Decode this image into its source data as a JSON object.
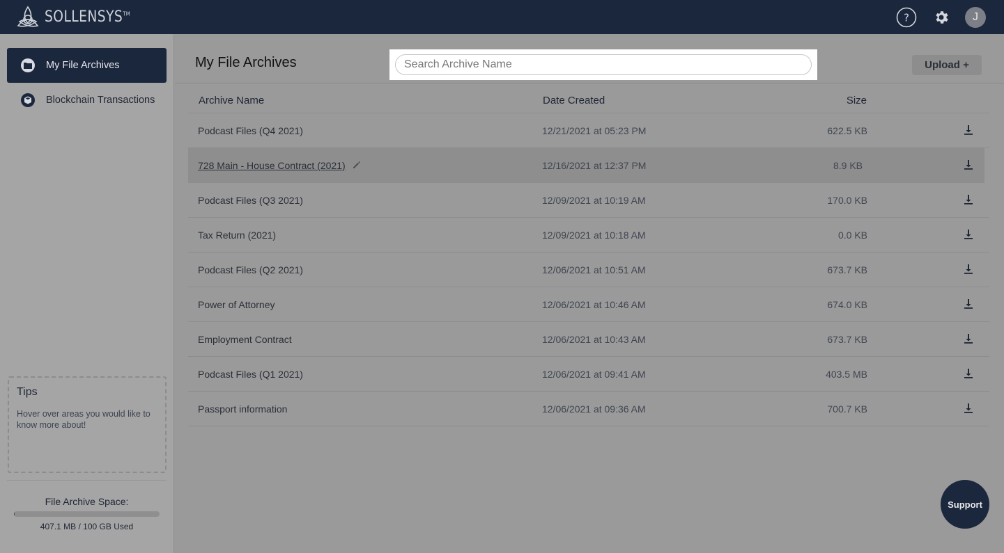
{
  "app": {
    "brand": "SOLLENSYS",
    "trademark": "TM"
  },
  "topbar": {
    "help_icon": "help-circle-icon",
    "settings_icon": "gear-icon",
    "avatar_initial": "J"
  },
  "sidebar": {
    "items": [
      {
        "label": "My File Archives",
        "icon": "folder-icon",
        "active": true
      },
      {
        "label": "Blockchain Transactions",
        "icon": "cube-icon",
        "active": false
      }
    ],
    "tips": {
      "title": "Tips",
      "text": "Hover over areas you would like to know more about!"
    },
    "storage": {
      "title": "File Archive Space:",
      "used_label": "407.1 MB / 100 GB Used",
      "fraction_used": 0.004
    }
  },
  "main": {
    "title": "My File Archives",
    "search": {
      "placeholder": "Search Archive Name",
      "value": ""
    },
    "upload_label": "Upload +",
    "columns": {
      "name": "Archive Name",
      "date": "Date Created",
      "size": "Size"
    },
    "rows": [
      {
        "name": "Podcast Files (Q4 2021)",
        "date": "12/21/2021 at 05:23 PM",
        "size": "622.5 KB"
      },
      {
        "name": "728 Main - House Contract (2021)",
        "date": "12/16/2021 at 12:37 PM",
        "size": "8.9 KB",
        "hover": true
      },
      {
        "name": "Podcast Files (Q3 2021)",
        "date": "12/09/2021 at 10:19 AM",
        "size": "170.0 KB"
      },
      {
        "name": "Tax Return (2021)",
        "date": "12/09/2021 at 10:18 AM",
        "size": "0.0 KB"
      },
      {
        "name": "Podcast Files (Q2 2021)",
        "date": "12/06/2021 at 10:51 AM",
        "size": "673.7 KB"
      },
      {
        "name": "Power of Attorney",
        "date": "12/06/2021 at 10:46 AM",
        "size": "674.0 KB"
      },
      {
        "name": "Employment Contract",
        "date": "12/06/2021 at 10:43 AM",
        "size": "673.7 KB"
      },
      {
        "name": "Podcast Files (Q1 2021)",
        "date": "12/06/2021 at 09:41 AM",
        "size": "403.5 MB"
      },
      {
        "name": "Passport information",
        "date": "12/06/2021 at 09:36 AM",
        "size": "700.7 KB"
      }
    ],
    "support_label": "Support"
  },
  "colors": {
    "navy": "#1b273d",
    "overlay_gray": "#9a9a9a",
    "white": "#ffffff"
  }
}
